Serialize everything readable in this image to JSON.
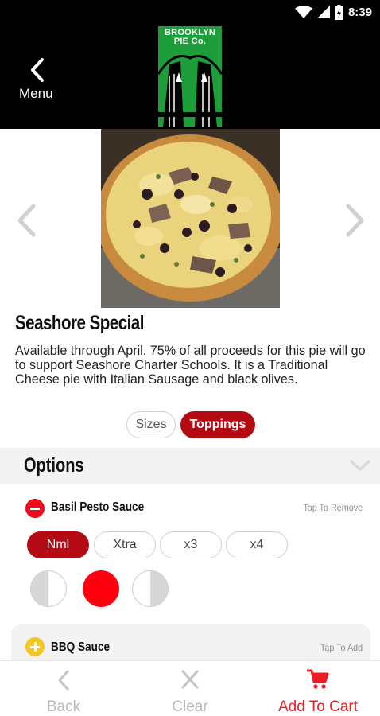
{
  "status_bar": {
    "time": "8:39",
    "icons": [
      "wifi-icon",
      "signal-icon",
      "battery-icon"
    ]
  },
  "header": {
    "back_label": "Menu",
    "logo_text_line1": "BROOKLYN",
    "logo_text_line2": "PIE Co."
  },
  "product": {
    "title": "Seashore Special",
    "description": "Available through April.  75% of all proceeds for this pie will go to support Seashore Charter Schools.  It is a Traditional Cheese pie with Italian Sausage and black olives."
  },
  "tabs": [
    {
      "label": "Sizes",
      "selected": false
    },
    {
      "label": "Toppings",
      "selected": true
    }
  ],
  "options": {
    "title": "Options",
    "toppings": [
      {
        "name": "Basil Pesto Sauce",
        "action_hint": "Tap To Remove",
        "amounts": [
          "Nml",
          "Xtra",
          "x3",
          "x4"
        ],
        "selected_amount": "Nml",
        "placement": "whole"
      },
      {
        "name": "BBQ Sauce",
        "action_hint": "Tap To Add"
      }
    ]
  },
  "bottom_bar": {
    "back_label": "Back",
    "clear_label": "Clear",
    "cart_label": "Add To Cart"
  },
  "colors": {
    "accent_red": "#b40a14",
    "bright_red": "#ee1c25",
    "logo_green": "#1e9e3b",
    "add_yellow": "#f3c626"
  }
}
